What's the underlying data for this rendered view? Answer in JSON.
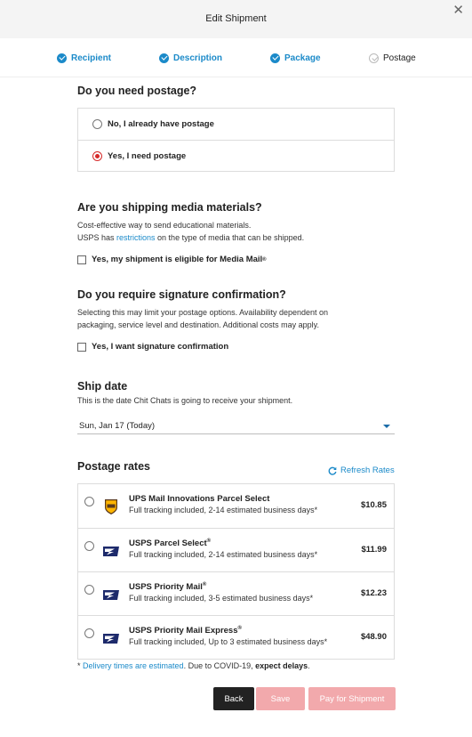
{
  "modal": {
    "title": "Edit Shipment",
    "close_glyph": "✕"
  },
  "steps": [
    {
      "label": "Recipient",
      "state": "done"
    },
    {
      "label": "Description",
      "state": "done"
    },
    {
      "label": "Package",
      "state": "done"
    },
    {
      "label": "Postage",
      "state": "pending"
    }
  ],
  "postage": {
    "heading": "Do you need postage?",
    "options": [
      {
        "label": "No, I already have postage",
        "selected": false
      },
      {
        "label": "Yes, I need postage",
        "selected": true
      }
    ]
  },
  "media": {
    "heading": "Are you shipping media materials?",
    "line1": "Cost-effective way to send educational materials.",
    "line2_pre": "USPS has ",
    "line2_link": "restrictions",
    "line2_post": " on the type of media that can be shipped.",
    "checkbox_label": "Yes, my shipment is eligible for Media Mail",
    "checkbox_sup": "®",
    "checked": false
  },
  "signature": {
    "heading": "Do you require signature confirmation?",
    "line1": "Selecting this may limit your postage options. Availability dependent on",
    "line2": "packaging, service level and destination. Additional costs may apply.",
    "checkbox_label": "Yes, I want signature confirmation",
    "checked": false
  },
  "ship_date": {
    "heading": "Ship date",
    "description": "This is the date Chit Chats is going to receive your shipment.",
    "selected": "Sun, Jan 17 (Today)"
  },
  "rates": {
    "heading": "Postage rates",
    "refresh_label": "Refresh Rates",
    "items": [
      {
        "carrier": "ups-logo",
        "name": "UPS Mail Innovations Parcel Select",
        "name_sup": "",
        "details": "Full tracking included, 2-14 estimated business days*",
        "price": "$10.85"
      },
      {
        "carrier": "usps-logo",
        "name": "USPS Parcel Select",
        "name_sup": "®",
        "details": "Full tracking included, 2-14 estimated business days*",
        "price": "$11.99"
      },
      {
        "carrier": "usps-logo",
        "name": "USPS Priority Mail",
        "name_sup": "®",
        "details": "Full tracking included, 3-5 estimated business days*",
        "price": "$12.23"
      },
      {
        "carrier": "usps-logo",
        "name": "USPS Priority Mail Express",
        "name_sup": "®",
        "details": "Full tracking included, Up to 3 estimated business days*",
        "price": "$48.90"
      }
    ]
  },
  "footnote": {
    "star": "* ",
    "link": "Delivery times are estimated",
    "mid": ". Due to COVID-19, ",
    "bold": "expect delays",
    "end": "."
  },
  "buttons": {
    "back": "Back",
    "save": "Save",
    "pay": "Pay for Shipment"
  },
  "colors": {
    "accent": "#1b8ac9",
    "selected_radio": "#d62a2a",
    "disabled_button": "#f2a9ac",
    "dark_button": "#222222"
  },
  "icons": {
    "step_check": "check-circle-icon",
    "close": "close-icon",
    "refresh": "refresh-icon",
    "caret": "chevron-down-icon"
  }
}
